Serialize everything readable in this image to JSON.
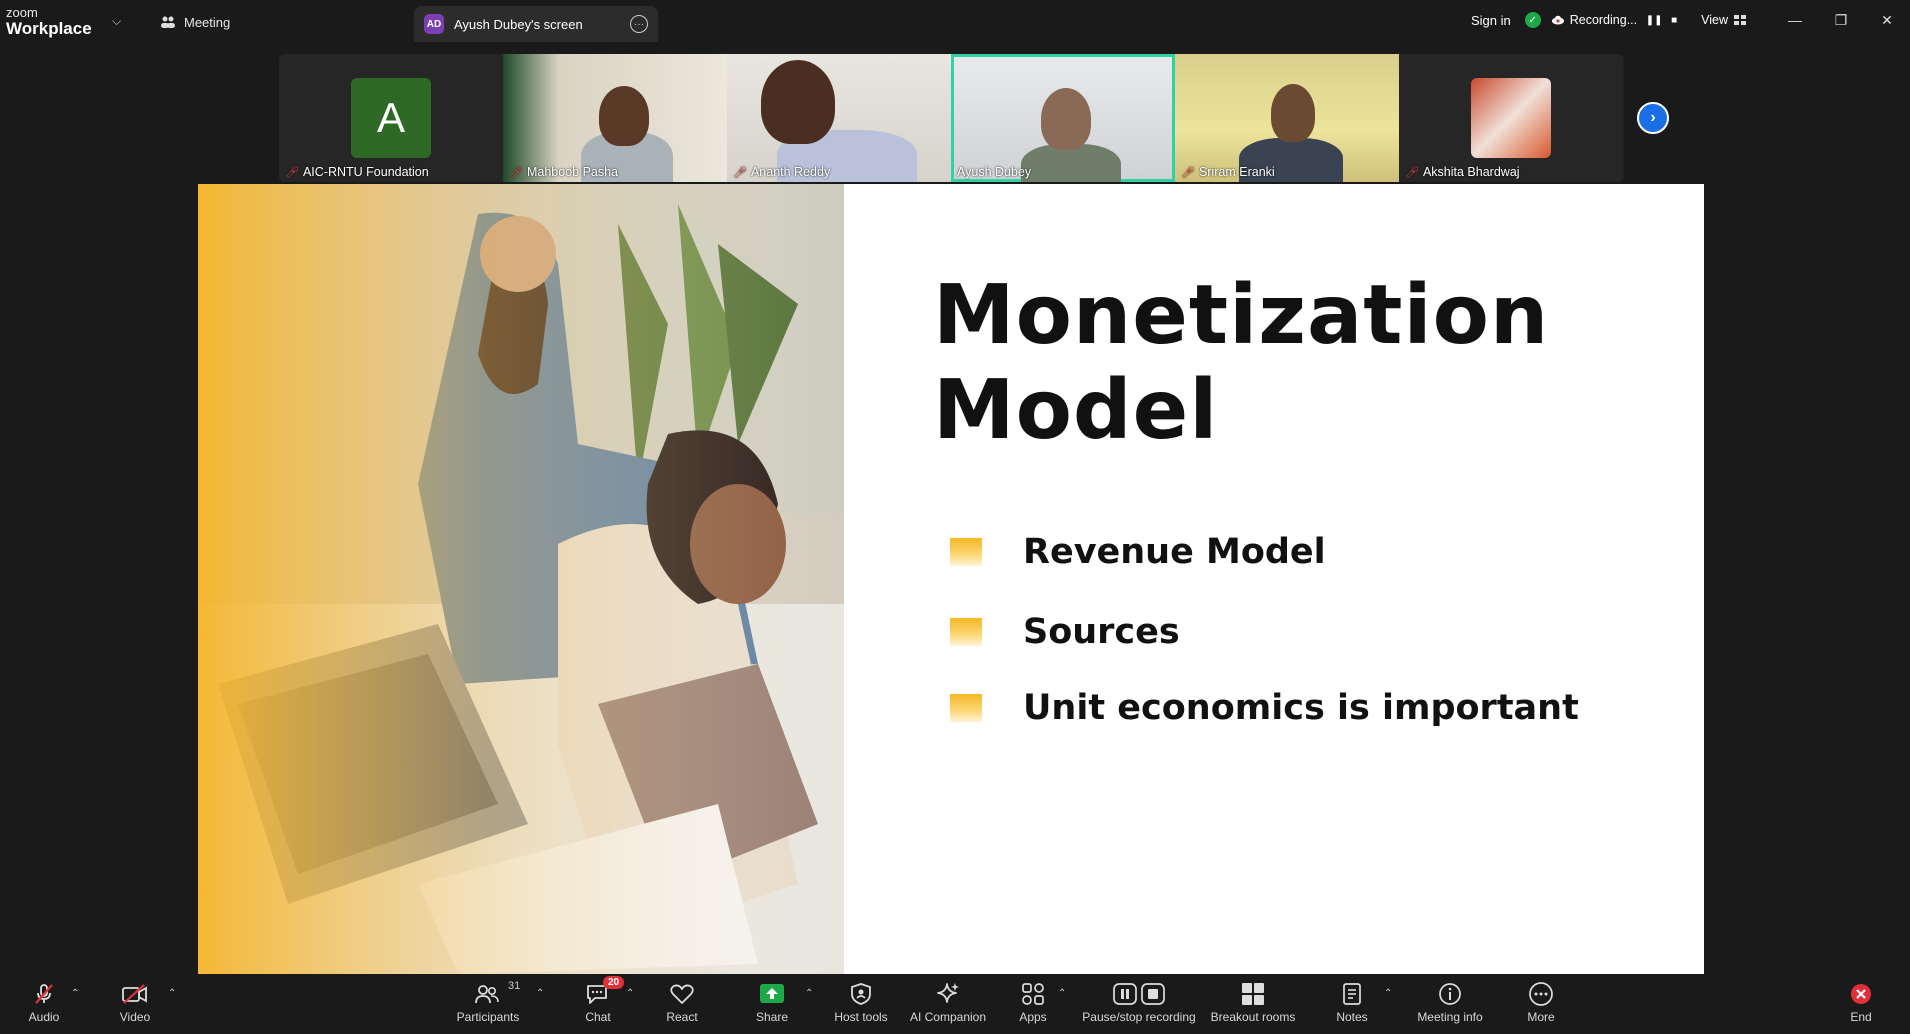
{
  "titlebar": {
    "brand_top": "zoom",
    "brand_bottom": "Workplace",
    "meeting_label": "Meeting",
    "share_tab": {
      "initials": "AD",
      "label": "Ayush Dubey's screen"
    },
    "sign_in": "Sign in",
    "recording": "Recording...",
    "view": "View"
  },
  "participants": [
    {
      "name": "AIC-RNTU Foundation",
      "avatar_letter": "A",
      "muted": true
    },
    {
      "name": "Mahboob Pasha",
      "muted": true
    },
    {
      "name": "Ananth Reddy",
      "muted": true
    },
    {
      "name": "Ayush Dubey",
      "muted": false,
      "active": true
    },
    {
      "name": "Sriram Eranki",
      "muted": true
    },
    {
      "name": "Akshita Bhardwaj",
      "muted": true
    }
  ],
  "slide": {
    "title_line1": "Monetization",
    "title_line2": "Model",
    "bullets": [
      "Revenue Model",
      "Sources",
      "Unit economics is important"
    ]
  },
  "toolbar": {
    "audio": "Audio",
    "video": "Video",
    "participants": "Participants",
    "participants_count": "31",
    "chat": "Chat",
    "chat_badge": "20",
    "react": "React",
    "share": "Share",
    "host_tools": "Host tools",
    "ai_companion": "AI Companion",
    "apps": "Apps",
    "pause_stop_recording": "Pause/stop recording",
    "breakout_rooms": "Breakout rooms",
    "notes": "Notes",
    "meeting_info": "Meeting info",
    "more": "More",
    "end": "End"
  },
  "colors": {
    "active_speaker_border": "#2ed3a5",
    "share_green": "#1ea84a",
    "end_red": "#e0313a",
    "slide_accent": "#f7b824"
  }
}
